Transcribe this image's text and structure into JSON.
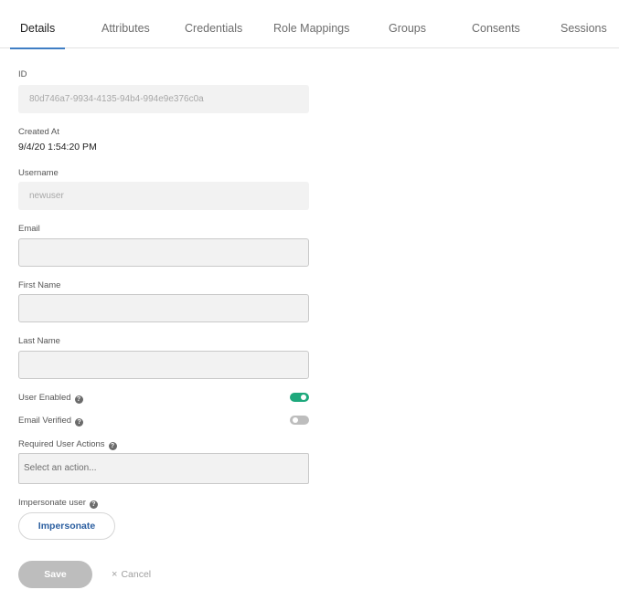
{
  "tabs": [
    {
      "label": "Details",
      "active": true
    },
    {
      "label": "Attributes"
    },
    {
      "label": "Credentials"
    },
    {
      "label": "Role Mappings"
    },
    {
      "label": "Groups"
    },
    {
      "label": "Consents"
    },
    {
      "label": "Sessions"
    }
  ],
  "form": {
    "id": {
      "label": "ID",
      "value": "80d746a7-9934-4135-94b4-994e9e376c0a"
    },
    "created_at": {
      "label": "Created At",
      "value": "9/4/20 1:54:20 PM"
    },
    "username": {
      "label": "Username",
      "value": "newuser"
    },
    "email": {
      "label": "Email",
      "value": ""
    },
    "first_name": {
      "label": "First Name",
      "value": ""
    },
    "last_name": {
      "label": "Last Name",
      "value": ""
    },
    "user_enabled": {
      "label": "User Enabled",
      "on": true
    },
    "email_verified": {
      "label": "Email Verified",
      "on": false
    },
    "required_actions": {
      "label": "Required User Actions",
      "placeholder": "Select an action..."
    },
    "impersonate": {
      "label": "Impersonate user",
      "button": "Impersonate"
    }
  },
  "actions": {
    "save": "Save",
    "cancel": "Cancel",
    "cancel_icon": "×"
  },
  "icons": {
    "help": "question-circle-icon",
    "cancel": "close-icon"
  },
  "colors": {
    "active_tab_underline": "#3f7ec4",
    "toggle_on": "#1ea87c",
    "toggle_off": "#bdbdbd",
    "impersonate_text": "#2c5fa0",
    "save_disabled": "#bdbdbd"
  }
}
